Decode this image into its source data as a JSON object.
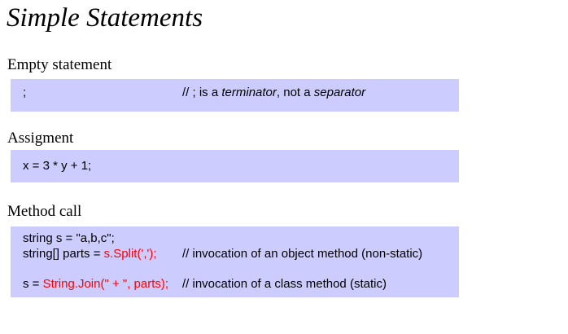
{
  "title": "Simple Statements",
  "sections": [
    {
      "heading": "Empty statement",
      "code": ";",
      "comment_parts": [
        "// ; is a ",
        "terminator",
        ", not a ",
        "separator"
      ]
    },
    {
      "heading": "Assigment",
      "code": "x = 3 * y + 1;"
    },
    {
      "heading": "Method call",
      "lines": [
        {
          "code": "string s = \"a,b,c\";"
        },
        {
          "prefix": "string[] parts = ",
          "highlight": "s.Split(',');",
          "comment": "// invocation of an object method (non-static)"
        },
        {
          "prefix": "s = ",
          "highlight": "String.Join(\" + \", parts);",
          "comment": "// invocation of a class method (static)"
        }
      ]
    }
  ],
  "colors": {
    "code_background": "#ccccff",
    "highlight": "#ff0000"
  }
}
